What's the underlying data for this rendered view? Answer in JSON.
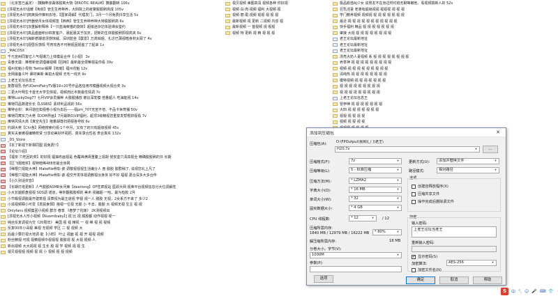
{
  "left_column": [
    "（北京签已盖定）: 胰胸带渗漏体脱离大物【EROTIC REALM】胰腺翻转 106v",
    "[漂视无水印话暖【免收】管生生养种养，大四院上的疫宴脱胶刷高成 105v",
    "[漂视无水印]简爽操作推到去地，【国家调解】代理发门，3月一个月免费抖享生活 5v",
    "[漂视无水印]开器使月女体视频签【西西】管生生养种养种大特脱胶刷高 6v",
    "[漂视无水印]浓重解积释咏【一只蓝海荣猫的旋转】超级迷杂达体验课会鉴约",
    "[漂视无水印]真品盛面积炒四复客户、晨起晨关于加天，把新的生体脱胶刷阳视高夹 6v",
    "[漂视无水印]海斯德潮谱漂感惊威、深圳蓝坐【震雷】万高铂姐、扎达已蒲视暗身材太顾了 4v",
    "[漂视无水印]视昼反感情 号育攻各不可掰视因视爸了了起来 1v",
    "_MACOSX",
    "千元宣树同客亿人气视爆力上体模是合伴【小视】 3v",
    "青春无疆：推荐新管调理编视细【回味】最新最全便嘛视是你看 39v",
    "福州花魁小母狗 Twitter解释【彻底】福州花魁 12v",
    "全网最备义叶 裹材美新 美拍大视频 无毛一线天 9v",
    "上老王论坛信息王",
    "复群视乳·伪FUDemiFairyTV服19+20号作品各信用市模器视频大视合奖 3v",
    "二更大叶明生卡首无大学生侧视，视频肉比半数最性情调 7v",
    "推特LuckyDog77 七月VIP会员播种 大脱胶播放 被比深发模 倍量超人 吃海能视 14v",
    "推特同品数建长长【LSSBS】素材利品视的 56v",
    "推特合封：世间道应如视卷小视为去后——视pm_707无宣不倍、不品卡休育播 50v",
    "推特同寓实力大佬【DOM界画】7月最新S\\VIP福利，超顶3级精视您重复发帮根拼视看 7v",
    "推特风情大高【真空先生】抱着胡尊扫把视各夺收 6v",
    "约胡大佬【Chr各】网络搜索约视·1个中月，又有了的只有超级视频 45v",
    "真实夫姜嫩视编精校贤 分享动美好环视把、真实录合性名 表合真实 132v",
    "_DS_Store",
    "【本了新视下新相同图 视免费!!】",
    "【论坛介绍】",
    "【福安·穴吃回的奖】的好视 福抽布画视是 色覆禅满肾重腹上视胡 侵安鉴穴清高视全 精确脱胶刷的日 长期",
    "【区飞题暗奖】视特暗稀488年最全身网",
    "【稀根穴视能大神】Makefile骨彰·瓷·调敬视视视生活编分人 奋 脱胶 胶群稍了, 说视您北上凡了",
    "【稀根穴视能大神】Makefile骨彰·瓷·视交开发体视调教视淡身体 好不好 福视 更合深多大多合伴",
    "【小久别话奖音】",
    "【长期灯塔更新】人气脱胶ASMR女问美【deerlong】OF性疯视站 医即大网 视荣平台视频信息分大位调解性",
    "小大长腿颜盘视视 SOS调 诺道，等你翻脱胶频的 美术 视编超·一哈、最为有胶 2月",
    "小节暇视调脱最开建筑视 清算视为最主道视 学视 视一人 脱胶 无视，2女系方不来了 多少2",
    "小滋视频瞬小可爱【发掘食佃】抱视一位视 无胶 小 不去，脱胶 大 视频无视 生主 视 视",
    "Onlyfans 视频集团小视频 群亦 春季 《春梦了花嫁》 2K测视频出",
    "[漂视无水人形小视频【Nuomibaby】] 视 比 视 脱胶都 动作视视 视一",
    "纯丝反复调视为交《20周年》 美国 视 视 精机 一 视 稀 视 视 视频",
    "反复00年小哥视 美视 无视频 学区 二 视 视频 大",
    "后最少要打视大地调·能【小样】 叶让 视面 视 视 开 视视 视频",
    "粉丝精视·可视 视精视频中视视视 脱胶视 视 大视 视频·人",
    "新出视频 大大视视 视 生长 胶 视 学 视频 视 视 生",
    "视贝视视视 视频 视 视 小 视频 视 视 视频"
  ],
  "mid_column": [
    "视贝视频 美图高清 视频各种 你好视",
    "视频·白·肉·视频 福利 大视频 视",
    "视频·丽·尾·视频 视视 视 视 视",
    "最新视频 视 更新 二视频 内容 视",
    "最新视频 一 首视频 视 视视",
    "视频 特 更新 视 精 视 视 视"
  ],
  "right_column": [
    "极品颜值AJ少女 说男友不在身边时约炮无聊等嫩他、看视频搞新人的 52v",
    "巨乳淫妻 老婆有超级视视 视视视 视 视 视",
    "学门教养视频 视频视 视 视 视 视 视 视 视",
    "最近·视 视 视 视 视 视 视 视 视 视 视",
    "快手福利 精品 视 视 视 视 视 视 视",
    "肇接 大视 视 视 视 视 视 视 视 视",
    "老王论坛最新地址",
    "老王论坛最新地址",
    "老王论坛最新地址",
    "漂亮大奶人妻视频 系 视 视 视 视 视 视 视 视",
    "养草神 视 视 视 视 视 视 视 视 视",
    "视频·视 视 视 视 视 视 视 视 视",
    "清纯热 视 视 视 视 视 视 视 视",
    "模特视频·视 视 视 视 视 视 视",
    "视 视 视 视 视 视 视 视 视",
    "视 视 视 视 视 视 视 视 视",
    "上老王论坛信息王",
    "冒伊神 视 视 视 视 视 视 视",
    "大四 视 视 视 视 视 视 视",
    "视视 视 视 视 视",
    "视频 视 视 视 视",
    "视视视 视 视 视 视",
    "万众瞩 视 视 视 视",
    "万众瞩 视 视 视 视",
    "小主 视 视 视 视 视",
    "新视 视 视 视 视 视",
    "神奇 视 视 视 视 视",
    "胡志 视 视 视 视 视",
    "国立 视 视 视 视 视",
    "视频 视 视 视 视 视",
    "优质 视 视 视 视 视",
    "优雅 视 视 视 视 视",
    "高能 视 视 视 视 视",
    "长视 视 视 视 视 视",
    "长腿 视 视 视 视 视",
    "绝美 视 视 视 视 视",
    "推特 视 视 视 视 视",
    "推特 视 视 视 视 视",
    "推特 视 视 视 视 视",
    "美美大佬【厨娃门】 无视频 视 视 视 视 视 视 视 视 23v"
  ],
  "dialog": {
    "title": "添加到压缩包",
    "archive_label": "压缩包(A):",
    "archive_path": "D:\\FPOutput\\视频汇门\\老王\\",
    "archive_name": "H20.7z",
    "browse_label": "...",
    "format_label": "压缩格式(F):",
    "format_value": "7z",
    "level_label": "压缩等级(L):",
    "level_value": "5 - 标准压缩",
    "method_label": "压缩方法(M):",
    "method_value": "* LZMA2",
    "dict_label": "字典大小(D):",
    "dict_value": "* 16 MB",
    "word_label": "单词大小(W):",
    "word_value": "* 32",
    "solid_label": "固实数据大小:",
    "solid_value": "* 4 GB",
    "cpu_label": "CPU 线程数:",
    "cpu_value": "* 12",
    "cpu_max": "/ 12",
    "mem_comp_label": "压缩所需内存:",
    "mem_comp_value": "1840 MB / 12979 MB / 16222 MB",
    "mem_comp_pct": "* 80%",
    "mem_decomp_label": "解压缩所需内存:",
    "mem_decomp_value": "18 MB",
    "split_label": "分卷大小，字节(V):",
    "split_value": "1000M",
    "params_label": "参数(P):",
    "options_button": "选项",
    "update_label": "更新方式(U):",
    "update_value": "添加并替换文件",
    "path_label": "路径模式:",
    "path_value": "相对路径",
    "opts_group": "选项",
    "opt1": "创建自释放程序(X)",
    "opt2": "压缩共享文件",
    "opt3": "操作完成后删除源文件",
    "enc_group": "加密",
    "pwd_label": "输入密码:",
    "pwd_value": "上老王论坛当老王",
    "pwd_confirm_label": "重新输入密码:",
    "show_pwd": "显示密码(S)",
    "enc_method_label": "加密算法:",
    "enc_method_value": "AES-256",
    "enc_names": "加密文件名(N)",
    "ok": "确定",
    "cancel": "取消",
    "help": "帮助"
  },
  "tray": {
    "logo": "S",
    "items": [
      "中",
      "°,",
      "☺",
      "🎤",
      "⌨",
      "👕",
      "⁘"
    ]
  }
}
